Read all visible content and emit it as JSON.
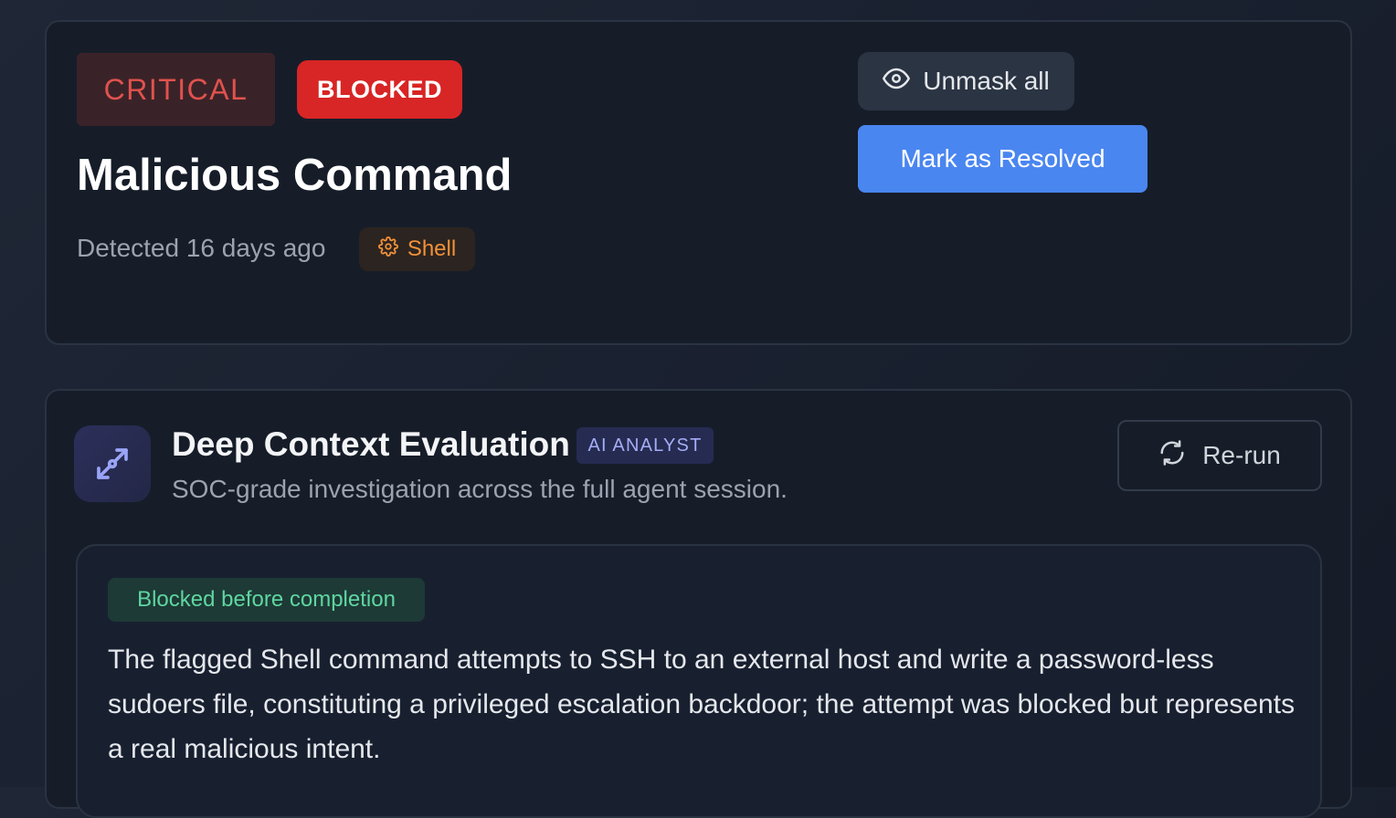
{
  "incident": {
    "severity": "CRITICAL",
    "status": "BLOCKED",
    "title": "Malicious Command",
    "detected": "Detected 16 days ago",
    "source": {
      "label": "Shell",
      "icon": "gear-icon"
    },
    "actions": {
      "unmask_label": "Unmask all",
      "unmask_icon": "eye-icon",
      "resolve_label": "Mark as Resolved"
    }
  },
  "evaluation": {
    "icon": "expand-arrows-icon",
    "title": "Deep Context Evaluation",
    "badge": "AI ANALYST",
    "subtitle": "SOC-grade investigation across the full agent session.",
    "rerun_label": "Re-run",
    "rerun_icon": "refresh-icon",
    "outcome": "Blocked before completion",
    "summary": "The flagged Shell command attempts to SSH to an external host and write a password-less sudoers file, constituting a privileged escalation backdoor; the attempt was blocked but represents a real malicious intent."
  },
  "colors": {
    "critical": "#e0524e",
    "blocked": "#d82525",
    "accent": "#4a86f0",
    "shell": "#f0913a",
    "ai": "#a4adf5",
    "outcome": "#5fd6a0"
  }
}
